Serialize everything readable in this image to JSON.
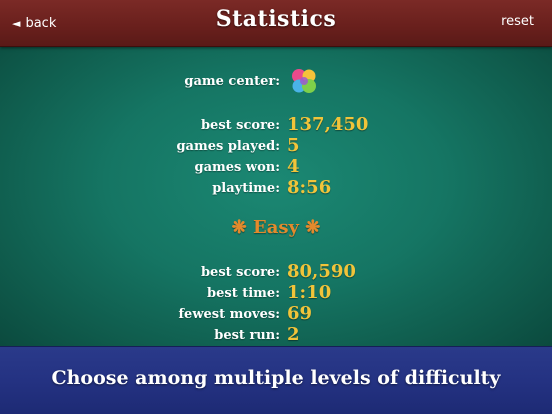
{
  "header": {
    "back_arrow": "◄",
    "back_label": "back",
    "title": "Statistics",
    "reset_label": "reset"
  },
  "game_center": {
    "label": "game center:",
    "icon": "game-center-bubbles-icon"
  },
  "overall": {
    "best_score_label": "best score:",
    "best_score_value": "137,450",
    "games_played_label": "games played:",
    "games_played_value": "5",
    "games_won_label": "games won:",
    "games_won_value": "4",
    "playtime_label": "playtime:",
    "playtime_value": "8:56"
  },
  "easy": {
    "section_title": "❋ Easy ❋",
    "best_score_label": "best score:",
    "best_score_value": "80,590",
    "best_time_label": "best time:",
    "best_time_value": "1:10",
    "fewest_moves_label": "fewest moves:",
    "fewest_moves_value": "69",
    "best_run_label": "best run:",
    "best_run_value": "2"
  },
  "footer": {
    "banner": "Choose among multiple levels of difficulty"
  },
  "colors": {
    "header_bg": "#6a201d",
    "felt": "#157563",
    "value_gold": "#f1c43a",
    "section_orange": "#e38a2c",
    "footer_bg": "#243282"
  }
}
